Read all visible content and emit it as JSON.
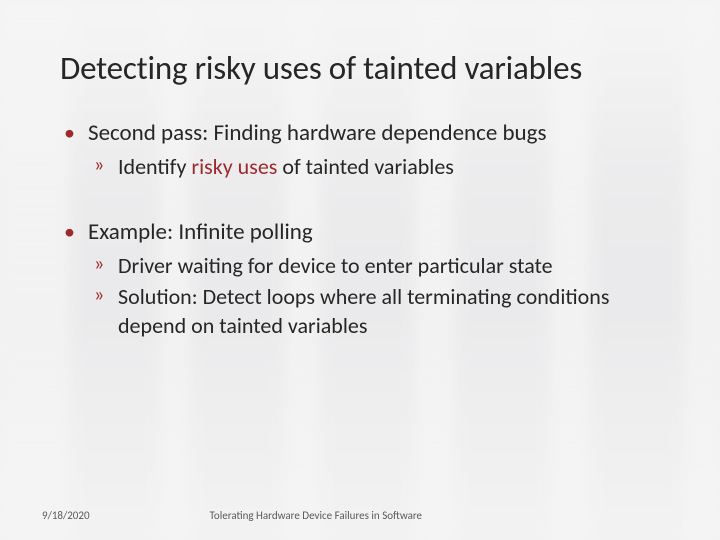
{
  "title": "Detecting risky uses of tainted variables",
  "bullets": {
    "b1": {
      "text": "Second pass: Finding hardware dependence bugs",
      "sub": [
        {
          "pre": "Identify ",
          "risky": "risky uses",
          "post": " of tainted variables"
        }
      ]
    },
    "b2": {
      "text": "Example: Infinite polling",
      "sub": [
        "Driver waiting for device to enter particular state",
        "Solution: Detect loops where all terminating conditions depend on tainted variables"
      ]
    }
  },
  "footer": {
    "date": "9/18/2020",
    "caption": "Tolerating Hardware Device Failures in Software"
  }
}
